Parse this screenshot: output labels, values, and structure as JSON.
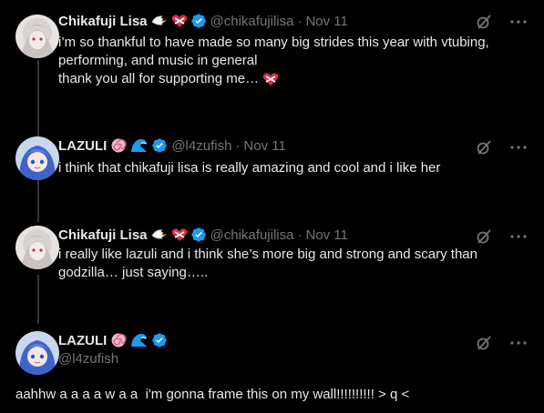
{
  "tweets": [
    {
      "name": "Chikafuji Lisa",
      "handle": "@chikafujilisa",
      "dot": "·",
      "date": "Nov 11",
      "lines": [
        "i’m so thankful to have made so many big strides this year with vtubing,",
        "performing, and music in general",
        "thank you all for supporting me…"
      ]
    },
    {
      "name": "LAZULI",
      "handle": "@l4zufish",
      "dot": "·",
      "date": "Nov 11",
      "lines": [
        "i think that chikafuji lisa is really amazing and cool and i like her"
      ]
    },
    {
      "name": "Chikafuji Lisa",
      "handle": "@chikafujilisa",
      "dot": "·",
      "date": "Nov 11",
      "lines": [
        "i really like lazuli and i think she’s more big and strong and scary than",
        "godzilla… just saying….."
      ]
    }
  ],
  "main": {
    "name": "LAZULI",
    "handle": "@l4zufish",
    "text": "aahhw a a a a w a a  i'm gonna frame this on my wall!!!!!!!!!! > q <"
  },
  "colors": {
    "background": "#000000",
    "text": "#e7e9ea",
    "muted": "#71767b",
    "verified": "#1d9bf0",
    "thread_line": "#333639"
  },
  "icons": [
    "grok-icon",
    "more-icon",
    "verified-badge-icon",
    "heart-ribbon-emoji",
    "wing-emoji",
    "swirl-emoji",
    "wave-emoji"
  ]
}
